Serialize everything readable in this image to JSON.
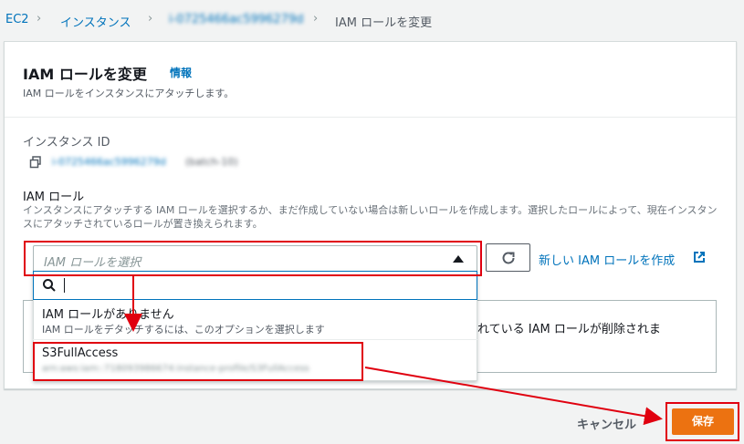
{
  "breadcrumb": {
    "ec2": "EC2",
    "instances": "インスタンス",
    "instance_id": "i-0725466ac5996279d",
    "current": "IAM ロールを変更"
  },
  "panel": {
    "title": "IAM ロールを変更",
    "info": "情報",
    "description": "IAM ロールをインスタンスにアタッチします。"
  },
  "instance": {
    "label": "インスタンス ID",
    "id": "i-0725466ac5996279d",
    "name": "(batch-10)"
  },
  "role": {
    "label": "IAM ロール",
    "description": "インスタンスにアタッチする IAM ロールを選択するか、まだ作成していない場合は新しいロールを作成します。選択したロールによって、現在インスタンスにアタッチされているロールが置き換えられます。",
    "placeholder": "IAM ロールを選択",
    "create_link": "新しい IAM ロールを作成"
  },
  "dropdown": {
    "filter_value": "",
    "options": [
      {
        "label": "IAM ロールがありません",
        "description": "IAM ロールをデタッチするには、このオプションを選択します"
      },
      {
        "label": "S3FullAccess",
        "arn": "arn:aws:iam::718093986674:instance-profile/S3FullAccess"
      }
    ]
  },
  "alert": {
    "text": "れている IAM ロールが削除されま"
  },
  "footer": {
    "cancel": "キャンセル",
    "save": "保存"
  },
  "colors": {
    "link": "#0073bb",
    "primary": "#ec7211",
    "annotation": "#e0000f"
  }
}
